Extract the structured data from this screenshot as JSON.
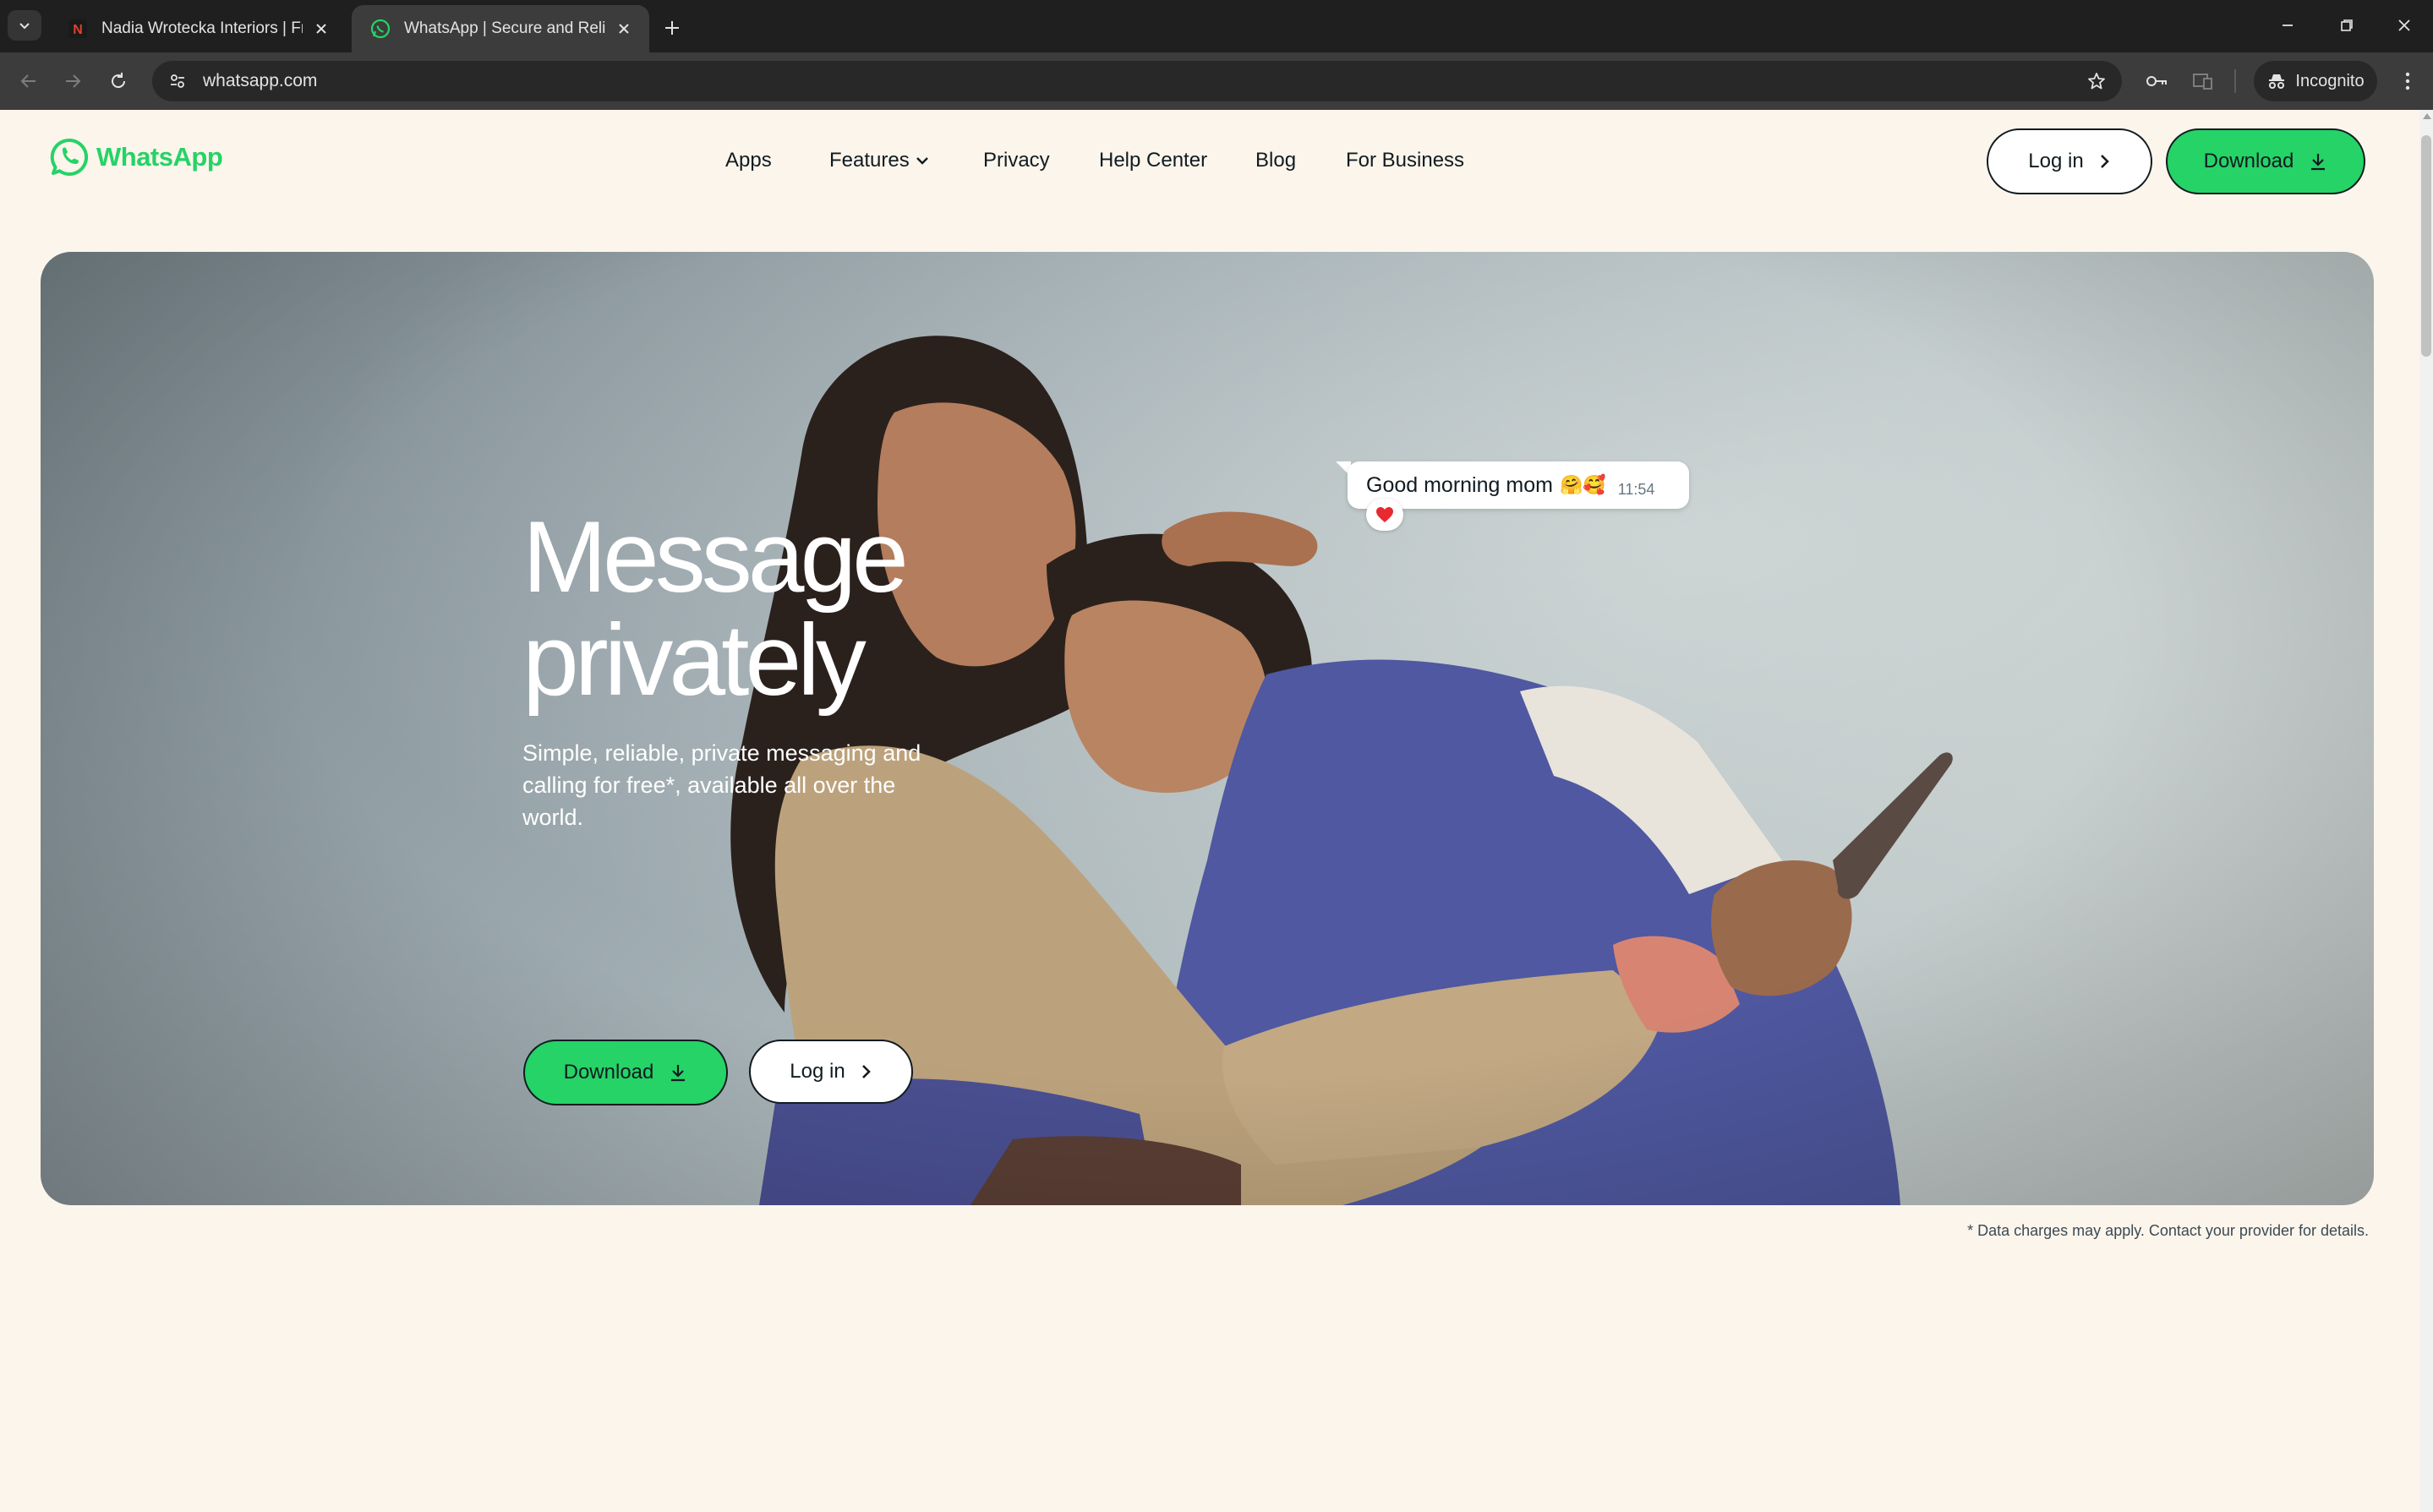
{
  "browser": {
    "tabs": [
      {
        "title": "Nadia Wrotecka Interiors | Free",
        "favicon": "N",
        "active": false
      },
      {
        "title": "WhatsApp | Secure and Reliable",
        "active": true
      }
    ],
    "url": "whatsapp.com",
    "incognito_label": "Incognito"
  },
  "header": {
    "logo_text": "WhatsApp",
    "nav": [
      "Apps",
      "Features",
      "Privacy",
      "Help Center",
      "Blog",
      "For Business"
    ],
    "login_label": "Log in",
    "download_label": "Download"
  },
  "hero": {
    "title_line1": "Message",
    "title_line2": "privately",
    "subtitle": "Simple, reliable, private messaging and calling for free*, available all over the world.",
    "download_label": "Download",
    "login_label": "Log in",
    "chat_bubble": {
      "text": "Good morning mom",
      "emojis": "🤗🥰",
      "time": "11:54",
      "reaction": "❤️"
    }
  },
  "footer_note": "* Data charges may apply. Contact your provider for details.",
  "colors": {
    "brand_green": "#25d366",
    "page_bg": "#fcf5eb",
    "text_dark": "#111b21"
  }
}
